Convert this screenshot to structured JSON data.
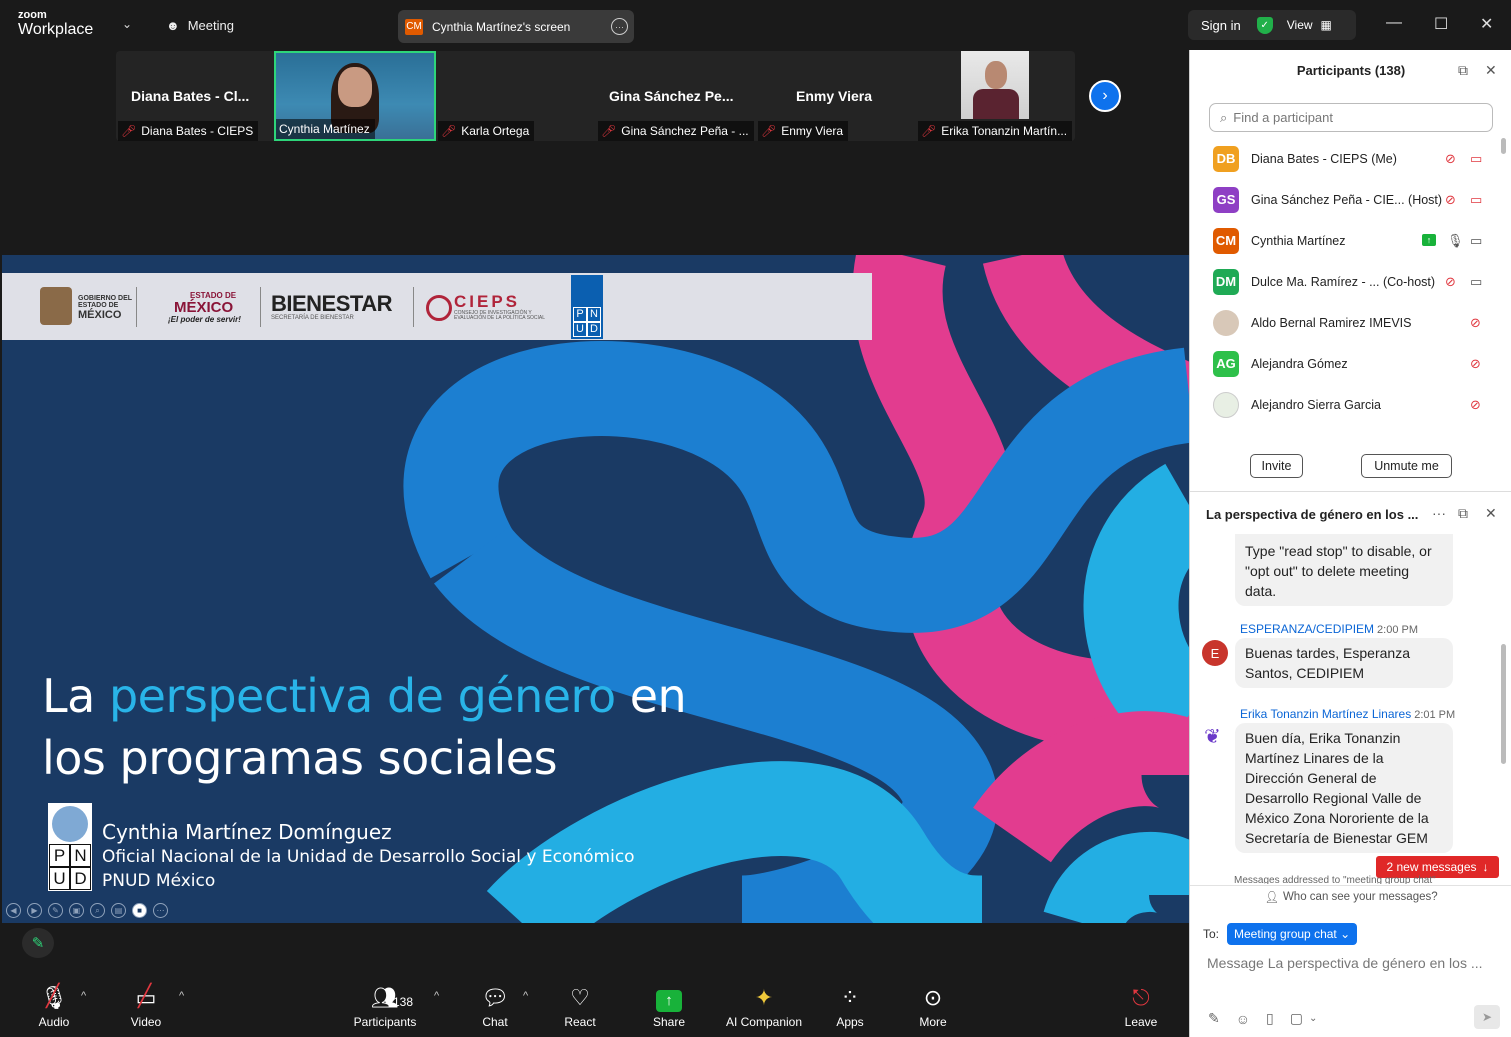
{
  "titlebar": {
    "brand_top": "zoom",
    "brand_bottom": "Workplace",
    "meeting_label": "Meeting",
    "screen_badge": "CM",
    "screen_label": "Cynthia Martínez's screen",
    "sign_in": "Sign in",
    "view": "View"
  },
  "strip": {
    "tiles": [
      {
        "big": "Diana Bates - Cl...",
        "tag": "Diana Bates - CIEPS"
      },
      {
        "big": "",
        "tag": "Cynthia Martínez"
      },
      {
        "big": "",
        "tag": "Karla Ortega"
      },
      {
        "big": "Gina Sánchez Pe...",
        "tag": "Gina Sánchez Peña - ..."
      },
      {
        "big": "Enmy Viera",
        "tag": "Enmy Viera"
      },
      {
        "big": "",
        "tag": "Erika Tonanzin Martín..."
      }
    ]
  },
  "slide": {
    "logos": {
      "gob1": "GOBIERNO DEL",
      "gob2": "ESTADO DE",
      "gob3": "MÉXICO",
      "edo1": "ESTADO DE",
      "edo2": "MÉXICO",
      "edo3": "¡El poder de servir!",
      "bienestar": "BIENESTAR",
      "bienestar_sub": "SECRETARÍA DE BIENESTAR",
      "cieps": "CIEPS",
      "cieps_sub1": "CONSEJO DE INVESTIGACIÓN Y",
      "cieps_sub2": "EVALUACIÓN DE LA POLÍTICA SOCIAL",
      "pnud": [
        "P",
        "N",
        "U",
        "D"
      ]
    },
    "title_pre": "La ",
    "title_hl": "perspectiva de género",
    "title_post": " en",
    "title_line2": "los programas sociales",
    "presenter_name": "Cynthia Martínez Domínguez",
    "presenter_role": "Oficial Nacional de la Unidad de Desarrollo Social y Económico",
    "presenter_org": "PNUD México"
  },
  "toolbar": {
    "audio": "Audio",
    "video": "Video",
    "participants": "Participants",
    "participants_count": "138",
    "chat": "Chat",
    "react": "React",
    "share": "Share",
    "ai": "AI Companion",
    "apps": "Apps",
    "more": "More",
    "leave": "Leave"
  },
  "participants_panel": {
    "title": "Participants (138)",
    "search_placeholder": "Find a participant",
    "list": [
      {
        "initials": "DB",
        "color": "#f0a020",
        "name": "Diana Bates - CIEPS (Me)"
      },
      {
        "initials": "GS",
        "color": "#8e3fc4",
        "name": "Gina Sánchez Peña - CIE...  (Host)"
      },
      {
        "initials": "CM",
        "color": "#e05a00",
        "name": "Cynthia Martínez"
      },
      {
        "initials": "DM",
        "color": "#1faa55",
        "name": "Dulce Ma. Ramírez - ...  (Co-host)"
      },
      {
        "initials": "",
        "color": "#d8c8b8",
        "name": "Aldo Bernal Ramirez IMEVIS"
      },
      {
        "initials": "AG",
        "color": "#2ec04a",
        "name": "Alejandra Gómez"
      },
      {
        "initials": "",
        "color": "#e8efe4",
        "name": "Alejandro Sierra Garcia"
      }
    ],
    "invite": "Invite",
    "unmute": "Unmute me"
  },
  "chat_panel": {
    "title": "La perspectiva de género en los ...",
    "msg1": "Type \"read stop\" to disable, or \"opt out\" to delete meeting data.",
    "sender2": "ESPERANZA/CEDIPIEM",
    "time2": "2:00 PM",
    "av2": "E",
    "msg2": "Buenas tardes, Esperanza Santos, CEDIPIEM",
    "sender3": "Erika Tonanzin Martínez Linares",
    "time3": "2:01 PM",
    "msg3": "Buen día, Erika Tonanzin Martínez Linares de la Dirección General de Desarrollo Regional Valle de México Zona Nororiente de la Secretaría de Bienestar GEM",
    "new_messages": "2 new messages",
    "fine_print": "Messages addressed to \"meeting group chat\"",
    "who_can_see": "Who can see your messages?",
    "to_label": "To:",
    "to_target": "Meeting group chat",
    "input_placeholder": "Message La perspectiva de género en los ..."
  }
}
